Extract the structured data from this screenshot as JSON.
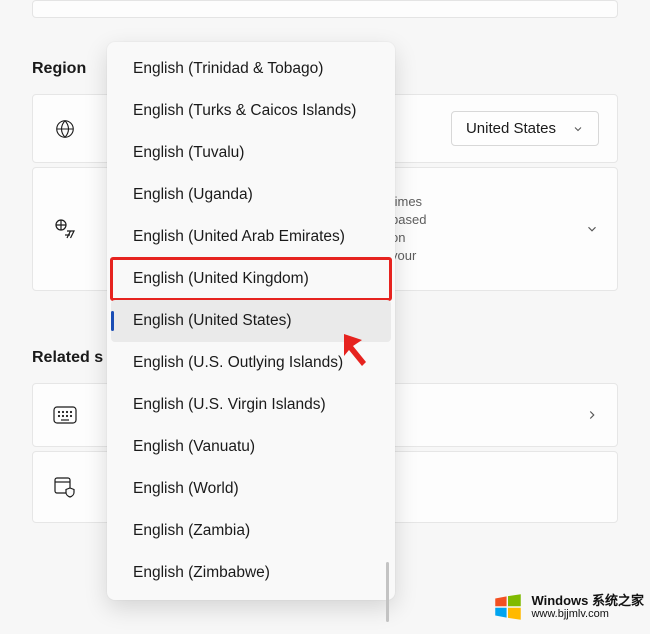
{
  "region": {
    "title": "Region",
    "country_value": "United States",
    "format_desc": "times based on your"
  },
  "related": {
    "title": "Related s"
  },
  "dropdown_items": [
    "English (Trinidad & Tobago)",
    "English (Turks & Caicos Islands)",
    "English (Tuvalu)",
    "English (Uganda)",
    "English (United Arab Emirates)",
    "English (United Kingdom)",
    "English (United States)",
    "English (U.S. Outlying Islands)",
    "English (U.S. Virgin Islands)",
    "English (Vanuatu)",
    "English (World)",
    "English (Zambia)",
    "English (Zimbabwe)"
  ],
  "dropdown_highlighted_index": 5,
  "dropdown_selected_index": 6,
  "watermark": {
    "line1": "Windows 系统之家",
    "line2": "www.bjjmlv.com"
  }
}
